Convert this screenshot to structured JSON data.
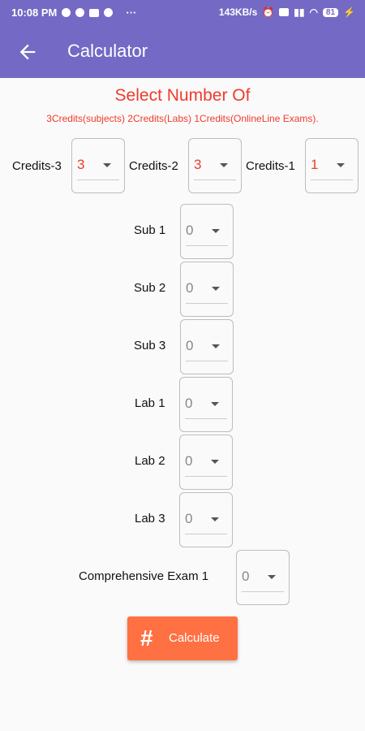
{
  "status_bar": {
    "time": "10:08 PM",
    "speed": "143KB/s",
    "battery": "81"
  },
  "app_bar": {
    "title": "Calculator"
  },
  "heading": {
    "title": "Select Number Of",
    "subtitle": "3Credits(subjects)  2Credits(Labs)  1Credits(OnlineLine Exams)."
  },
  "credits": [
    {
      "label": "Credits-3",
      "value": "3"
    },
    {
      "label": "Credits-2",
      "value": "3"
    },
    {
      "label": "Credits-1",
      "value": "1"
    }
  ],
  "rows": [
    {
      "label": "Sub 1",
      "value": "0"
    },
    {
      "label": "Sub 2",
      "value": "0"
    },
    {
      "label": "Sub 3",
      "value": "0"
    },
    {
      "label": "Lab 1",
      "value": "0"
    },
    {
      "label": "Lab 2",
      "value": "0"
    },
    {
      "label": "Lab 3",
      "value": "0"
    },
    {
      "label": "Comprehensive Exam 1",
      "value": "0"
    }
  ],
  "calculate_button": {
    "icon": "#",
    "label": "Calculate"
  },
  "colors": {
    "primary": "#7469c4",
    "accent": "#ff7043",
    "heading_red": "#ef3b2c"
  }
}
